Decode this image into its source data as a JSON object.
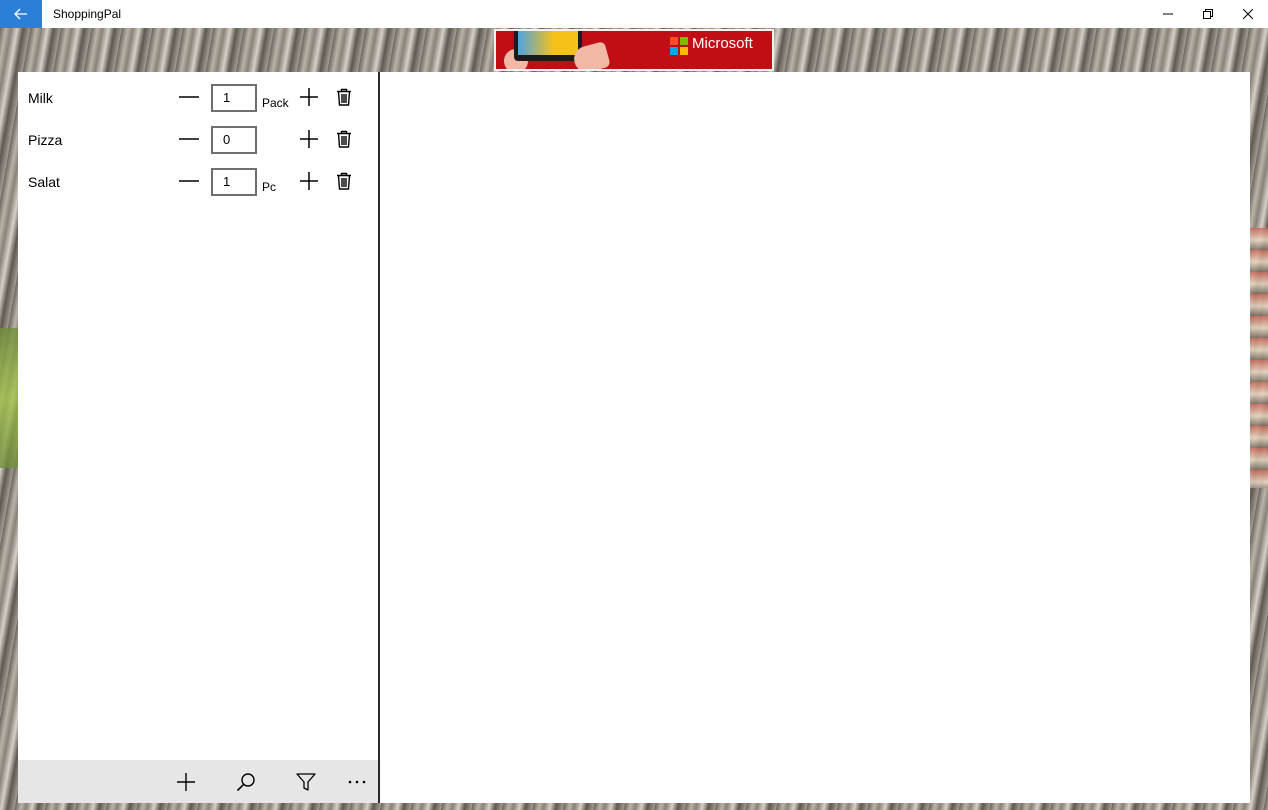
{
  "window": {
    "title": "ShoppingPal"
  },
  "ad": {
    "brand": "Microsoft"
  },
  "items": [
    {
      "name": "Milk",
      "quantity": "1",
      "unit": "Pack"
    },
    {
      "name": "Pizza",
      "quantity": "0",
      "unit": ""
    },
    {
      "name": "Salat",
      "quantity": "1",
      "unit": "Pc"
    }
  ],
  "commandbar": {
    "buttons": [
      "add-icon",
      "search-icon",
      "filter-icon",
      "more-icon"
    ]
  },
  "colors": {
    "accent": "#2b7fd6",
    "commandbar_bg": "#e6e6e6",
    "ad_bg": "#c00e14"
  }
}
